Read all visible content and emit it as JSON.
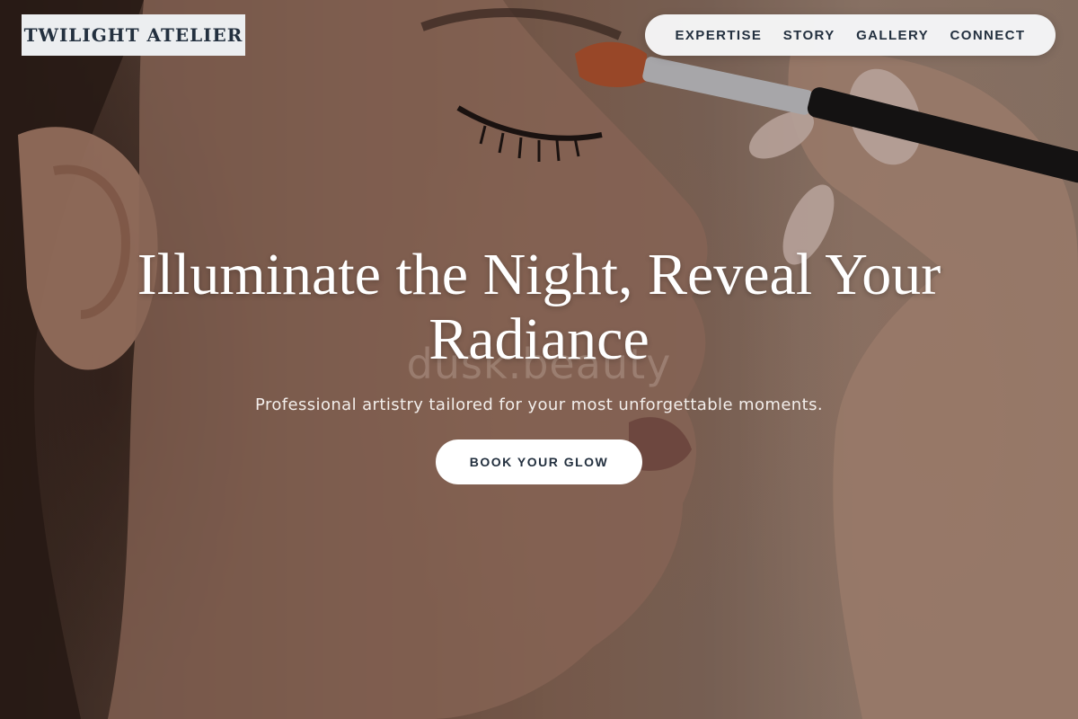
{
  "brand": {
    "name": "TWILIGHT ATELIER"
  },
  "nav": {
    "items": [
      {
        "label": "EXPERTISE"
      },
      {
        "label": "STORY"
      },
      {
        "label": "GALLERY"
      },
      {
        "label": "CONNECT"
      }
    ]
  },
  "hero": {
    "headline": "Illuminate the Night, Reveal Your Radiance",
    "subheadline": "Professional artistry tailored for your most unforgettable moments.",
    "cta_label": "BOOK YOUR GLOW",
    "watermark": "dusk.beauty",
    "image_alt": "Makeup artist applying eyeshadow with a brush to a woman's eyelid, side profile"
  },
  "colors": {
    "brand_text": "#23303f",
    "nav_background": "#f7f8f9",
    "cta_background": "#ffffff",
    "headline_text": "#ffffff"
  }
}
